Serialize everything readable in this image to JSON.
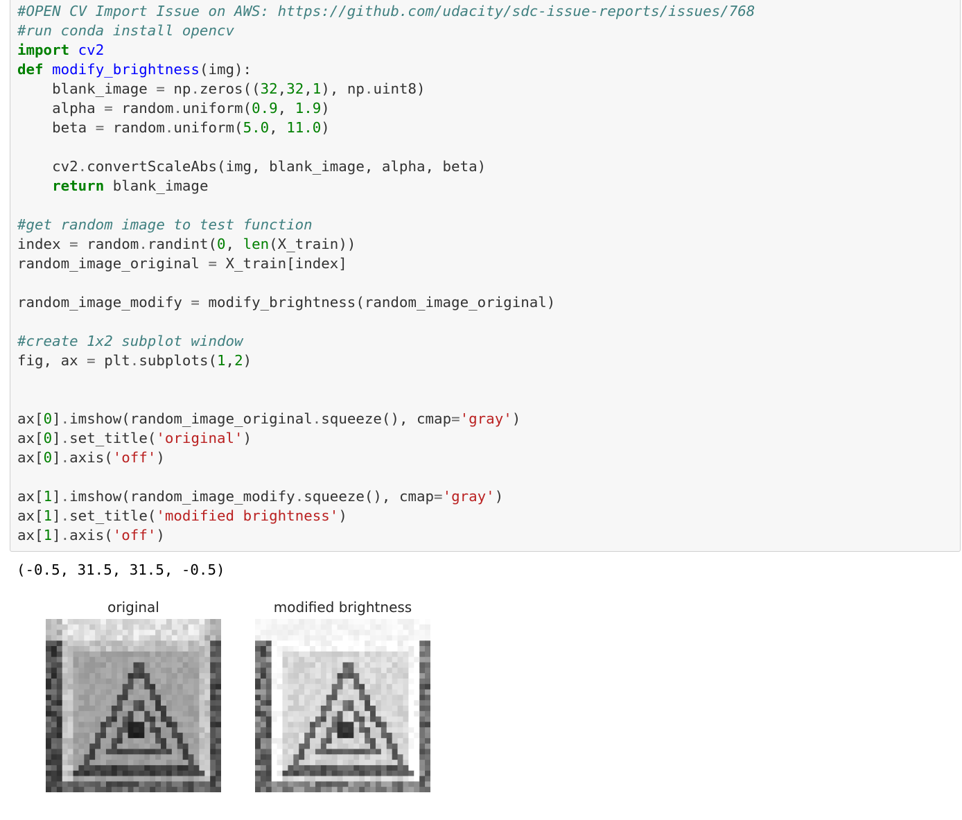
{
  "code": {
    "lines": [
      [
        {
          "t": "comment",
          "v": "#OPEN CV Import Issue on AWS: https://github.com/udacity/sdc-issue-reports/issues/768"
        }
      ],
      [
        {
          "t": "comment",
          "v": "#run conda install opencv"
        }
      ],
      [
        {
          "t": "kw",
          "v": "import"
        },
        {
          "t": "plain",
          "v": " "
        },
        {
          "t": "fn",
          "v": "cv2"
        }
      ],
      [
        {
          "t": "kw",
          "v": "def"
        },
        {
          "t": "plain",
          "v": " "
        },
        {
          "t": "fn",
          "v": "modify_brightness"
        },
        {
          "t": "plain",
          "v": "(img):"
        }
      ],
      [
        {
          "t": "plain",
          "v": "    blank_image "
        },
        {
          "t": "op",
          "v": "="
        },
        {
          "t": "plain",
          "v": " np"
        },
        {
          "t": "op",
          "v": "."
        },
        {
          "t": "plain",
          "v": "zeros(("
        },
        {
          "t": "num",
          "v": "32"
        },
        {
          "t": "plain",
          "v": ","
        },
        {
          "t": "num",
          "v": "32"
        },
        {
          "t": "plain",
          "v": ","
        },
        {
          "t": "num",
          "v": "1"
        },
        {
          "t": "plain",
          "v": "), np"
        },
        {
          "t": "op",
          "v": "."
        },
        {
          "t": "plain",
          "v": "uint8)"
        }
      ],
      [
        {
          "t": "plain",
          "v": "    alpha "
        },
        {
          "t": "op",
          "v": "="
        },
        {
          "t": "plain",
          "v": " random"
        },
        {
          "t": "op",
          "v": "."
        },
        {
          "t": "plain",
          "v": "uniform("
        },
        {
          "t": "num",
          "v": "0.9"
        },
        {
          "t": "plain",
          "v": ", "
        },
        {
          "t": "num",
          "v": "1.9"
        },
        {
          "t": "plain",
          "v": ")"
        }
      ],
      [
        {
          "t": "plain",
          "v": "    beta "
        },
        {
          "t": "op",
          "v": "="
        },
        {
          "t": "plain",
          "v": " random"
        },
        {
          "t": "op",
          "v": "."
        },
        {
          "t": "plain",
          "v": "uniform("
        },
        {
          "t": "num",
          "v": "5.0"
        },
        {
          "t": "plain",
          "v": ", "
        },
        {
          "t": "num",
          "v": "11.0"
        },
        {
          "t": "plain",
          "v": ")"
        }
      ],
      [],
      [
        {
          "t": "plain",
          "v": "    cv2"
        },
        {
          "t": "op",
          "v": "."
        },
        {
          "t": "plain",
          "v": "convertScaleAbs(img, blank_image, alpha, beta)"
        }
      ],
      [
        {
          "t": "plain",
          "v": "    "
        },
        {
          "t": "kw",
          "v": "return"
        },
        {
          "t": "plain",
          "v": " blank_image"
        }
      ],
      [],
      [
        {
          "t": "comment",
          "v": "#get random image to test function"
        }
      ],
      [
        {
          "t": "plain",
          "v": "index "
        },
        {
          "t": "op",
          "v": "="
        },
        {
          "t": "plain",
          "v": " random"
        },
        {
          "t": "op",
          "v": "."
        },
        {
          "t": "plain",
          "v": "randint("
        },
        {
          "t": "num",
          "v": "0"
        },
        {
          "t": "plain",
          "v": ", "
        },
        {
          "t": "builtin",
          "v": "len"
        },
        {
          "t": "plain",
          "v": "(X_train))"
        }
      ],
      [
        {
          "t": "plain",
          "v": "random_image_original "
        },
        {
          "t": "op",
          "v": "="
        },
        {
          "t": "plain",
          "v": " X_train[index]"
        }
      ],
      [],
      [
        {
          "t": "plain",
          "v": "random_image_modify "
        },
        {
          "t": "op",
          "v": "="
        },
        {
          "t": "plain",
          "v": " modify_brightness(random_image_original)"
        }
      ],
      [],
      [
        {
          "t": "comment",
          "v": "#create 1x2 subplot window"
        }
      ],
      [
        {
          "t": "plain",
          "v": "fig, ax "
        },
        {
          "t": "op",
          "v": "="
        },
        {
          "t": "plain",
          "v": " plt"
        },
        {
          "t": "op",
          "v": "."
        },
        {
          "t": "plain",
          "v": "subplots("
        },
        {
          "t": "num",
          "v": "1"
        },
        {
          "t": "plain",
          "v": ","
        },
        {
          "t": "num",
          "v": "2"
        },
        {
          "t": "plain",
          "v": ")"
        }
      ],
      [],
      [],
      [
        {
          "t": "plain",
          "v": "ax["
        },
        {
          "t": "num",
          "v": "0"
        },
        {
          "t": "plain",
          "v": "]"
        },
        {
          "t": "op",
          "v": "."
        },
        {
          "t": "plain",
          "v": "imshow(random_image_original"
        },
        {
          "t": "op",
          "v": "."
        },
        {
          "t": "plain",
          "v": "squeeze(), cmap"
        },
        {
          "t": "op",
          "v": "="
        },
        {
          "t": "str",
          "v": "'gray'"
        },
        {
          "t": "plain",
          "v": ")"
        }
      ],
      [
        {
          "t": "plain",
          "v": "ax["
        },
        {
          "t": "num",
          "v": "0"
        },
        {
          "t": "plain",
          "v": "]"
        },
        {
          "t": "op",
          "v": "."
        },
        {
          "t": "plain",
          "v": "set_title("
        },
        {
          "t": "str",
          "v": "'original'"
        },
        {
          "t": "plain",
          "v": ")"
        }
      ],
      [
        {
          "t": "plain",
          "v": "ax["
        },
        {
          "t": "num",
          "v": "0"
        },
        {
          "t": "plain",
          "v": "]"
        },
        {
          "t": "op",
          "v": "."
        },
        {
          "t": "plain",
          "v": "axis("
        },
        {
          "t": "str",
          "v": "'off'"
        },
        {
          "t": "plain",
          "v": ")"
        }
      ],
      [],
      [
        {
          "t": "plain",
          "v": "ax["
        },
        {
          "t": "num",
          "v": "1"
        },
        {
          "t": "plain",
          "v": "]"
        },
        {
          "t": "op",
          "v": "."
        },
        {
          "t": "plain",
          "v": "imshow(random_image_modify"
        },
        {
          "t": "op",
          "v": "."
        },
        {
          "t": "plain",
          "v": "squeeze(), cmap"
        },
        {
          "t": "op",
          "v": "="
        },
        {
          "t": "str",
          "v": "'gray'"
        },
        {
          "t": "plain",
          "v": ")"
        }
      ],
      [
        {
          "t": "plain",
          "v": "ax["
        },
        {
          "t": "num",
          "v": "1"
        },
        {
          "t": "plain",
          "v": "]"
        },
        {
          "t": "op",
          "v": "."
        },
        {
          "t": "plain",
          "v": "set_title("
        },
        {
          "t": "str",
          "v": "'modified brightness'"
        },
        {
          "t": "plain",
          "v": ")"
        }
      ],
      [
        {
          "t": "plain",
          "v": "ax["
        },
        {
          "t": "num",
          "v": "1"
        },
        {
          "t": "plain",
          "v": "]"
        },
        {
          "t": "op",
          "v": "."
        },
        {
          "t": "plain",
          "v": "axis("
        },
        {
          "t": "str",
          "v": "'off'"
        },
        {
          "t": "plain",
          "v": ")"
        }
      ]
    ]
  },
  "output": {
    "text": "(-0.5, 31.5, 31.5, -0.5)",
    "figure": {
      "subplots": [
        {
          "title": "original",
          "image": "warning-sign-grayscale-original"
        },
        {
          "title": "modified brightness",
          "image": "warning-sign-grayscale-brightened"
        }
      ]
    }
  },
  "colors": {
    "cell_background": "#f7f7f7",
    "cell_border": "#cfcfcf",
    "comment": "#408080",
    "keyword": "#008000",
    "function_name": "#0000ff",
    "string": "#ba2121",
    "number": "#008000",
    "operator": "#666666",
    "text": "#333333"
  }
}
